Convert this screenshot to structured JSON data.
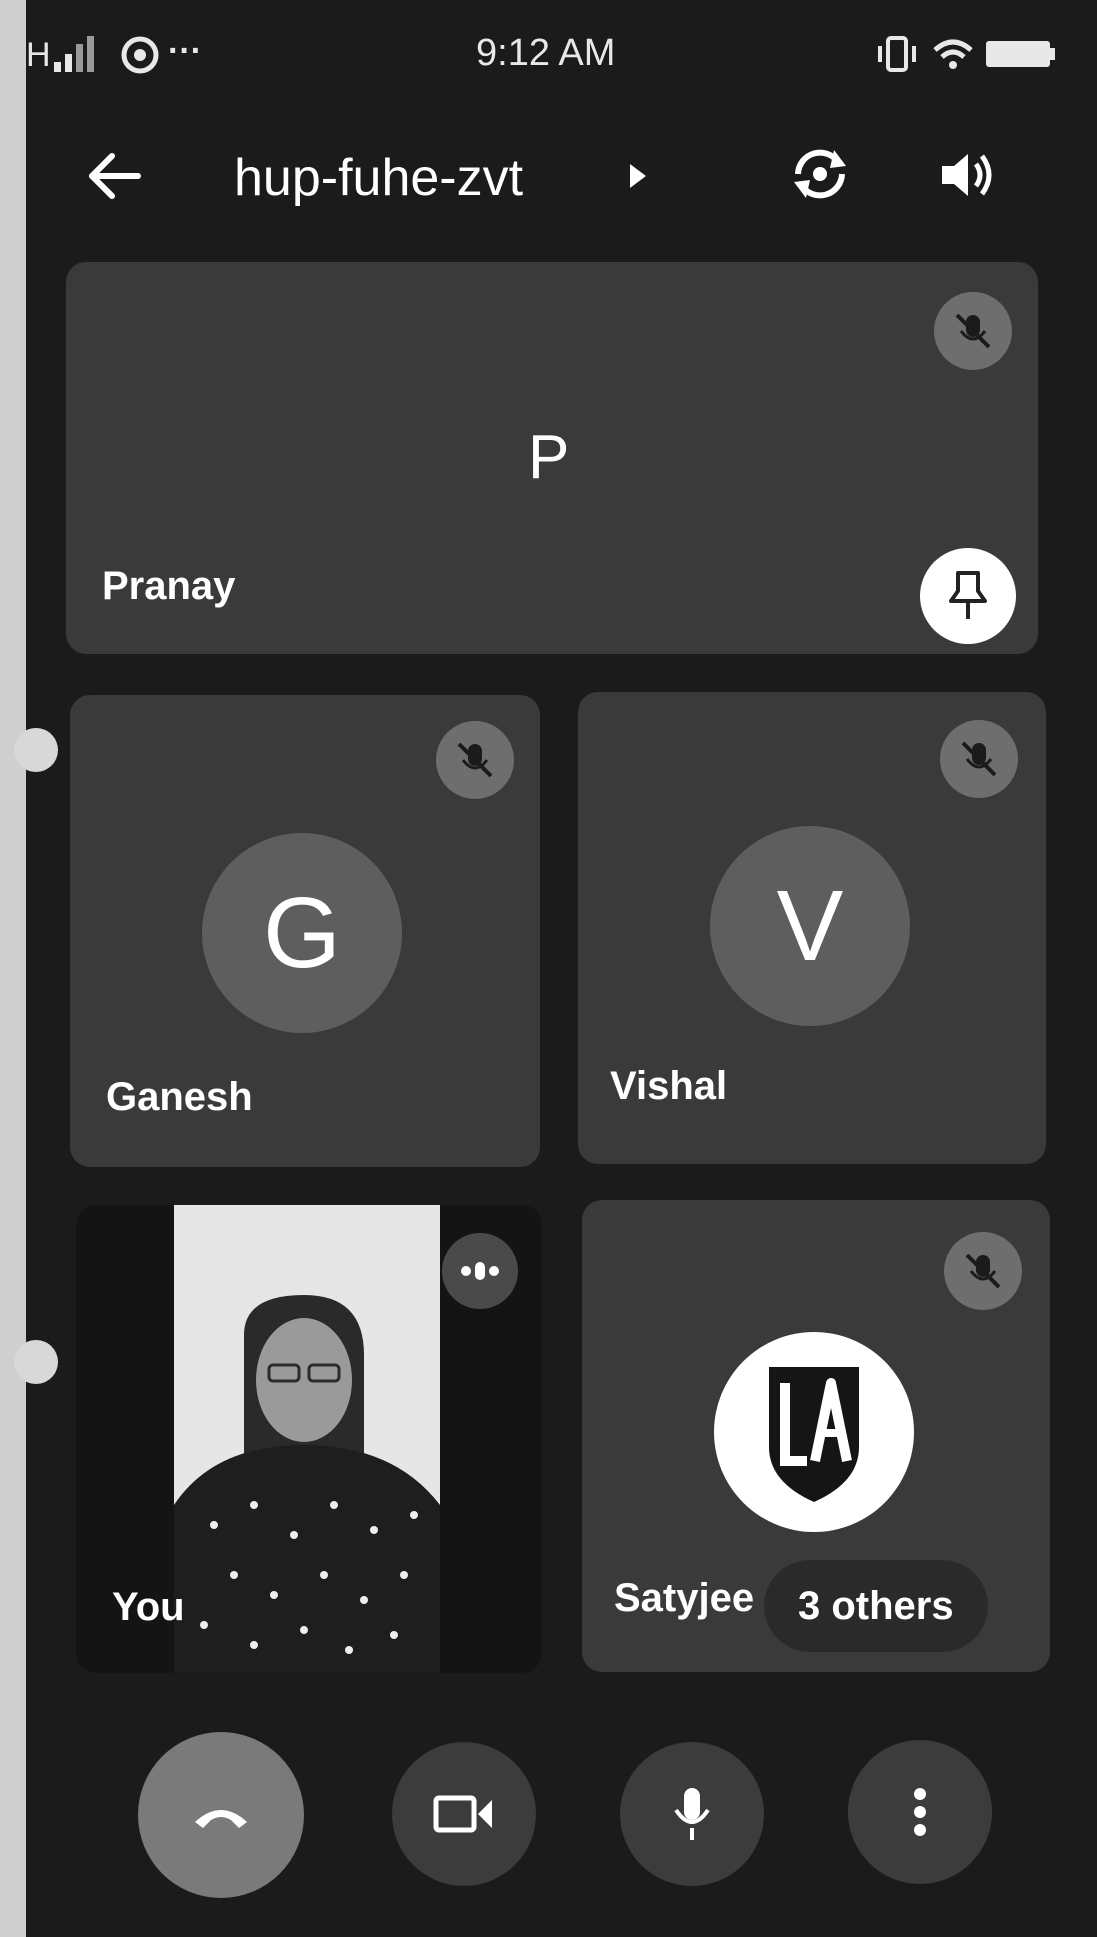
{
  "status_bar": {
    "time": "9:12 AM",
    "network_label": "H",
    "apps_more": "···"
  },
  "header": {
    "meeting_code": "hup-fuhe-zvt",
    "icons": [
      "back-arrow-icon",
      "chevron-right-icon",
      "switch-camera-icon",
      "speaker-icon"
    ]
  },
  "participants": [
    {
      "name": "Pranay",
      "initial": "P",
      "muted": true,
      "pinned": true
    },
    {
      "name": "Ganesh",
      "initial": "G",
      "muted": true
    },
    {
      "name": "Vishal",
      "initial": "V",
      "muted": true
    },
    {
      "name": "You",
      "self_view": true
    },
    {
      "name": "Satyjee",
      "muted": true,
      "logo_icon": "la-shield-logo"
    }
  ],
  "others_badge": "3 others",
  "controls": [
    {
      "name": "end-call",
      "icon": "phone-hangup-icon"
    },
    {
      "name": "camera",
      "icon": "video-camera-icon"
    },
    {
      "name": "microphone",
      "icon": "microphone-icon"
    },
    {
      "name": "more-options",
      "icon": "more-vertical-icon"
    }
  ],
  "colors": {
    "screen_bg": "#1b1b1b",
    "tile_bg": "#3a3a3a",
    "avatar_bg": "#5e5e5e",
    "muted_badge": "#6e6e6e",
    "end_call_bg": "#7a7a7a",
    "control_bg": "#3c3c3c"
  }
}
